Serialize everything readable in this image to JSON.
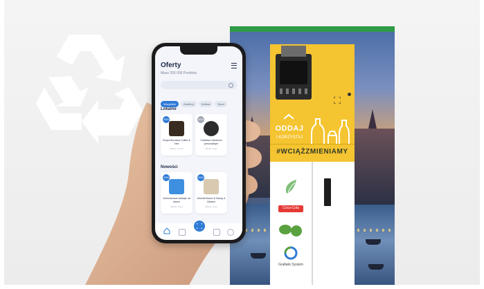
{
  "app": {
    "title": "Oferty",
    "subtitle": "Masz 200 000 Punktów",
    "search_placeholder": "",
    "chips": [
      "Wszystkie",
      "Zaoferuj",
      "Kultura",
      "Sport"
    ],
    "active_chip_index": 0
  },
  "sections": {
    "local": {
      "title": "Lokalne",
      "cards": [
        {
          "badge": "2000",
          "name": "Smycz/Ka łama Coffee & Vine",
          "meta": "Oferta • 12 km",
          "thumb_color": "#3a2b20",
          "badge_style": "blue"
        },
        {
          "badge": "2000",
          "name": "Ciadaha z tamerem personalnym",
          "meta": "Oferta • 5 km",
          "thumb_color": "#2c2c2c",
          "badge_style": "grey"
        }
      ]
    },
    "new": {
      "title": "Nowości",
      "cards": [
        {
          "badge": "1000",
          "name": "Jednorazowe koktajle na lasem",
          "meta": "Oferta • 8 km",
          "thumb_color": "#3f8fe0",
          "badge_style": "blue"
        },
        {
          "badge": "2000",
          "name": "Głośnik Bauch & Sanay & Olufsen",
          "meta": "Oferta • 4 km",
          "thumb_color": "#d8c9b0",
          "badge_style": "blue"
        }
      ]
    }
  },
  "machine": {
    "cta_title": "ODDAJ",
    "cta_subtitle": "I KORZYSTAJ",
    "hashtag": "#WCIĄŻZMIENIAMY",
    "logos": [
      "",
      "Coca-Cola",
      "",
      "Grallwik System"
    ]
  },
  "colors": {
    "brand_green": "#2f9a47",
    "machine_yellow": "#f5c431",
    "app_blue": "#2f7bd6"
  },
  "icons": {
    "recycle": "recycle-icon",
    "menu": "menu-icon",
    "search": "search-icon",
    "home": "home-icon",
    "scan": "scan-icon"
  }
}
